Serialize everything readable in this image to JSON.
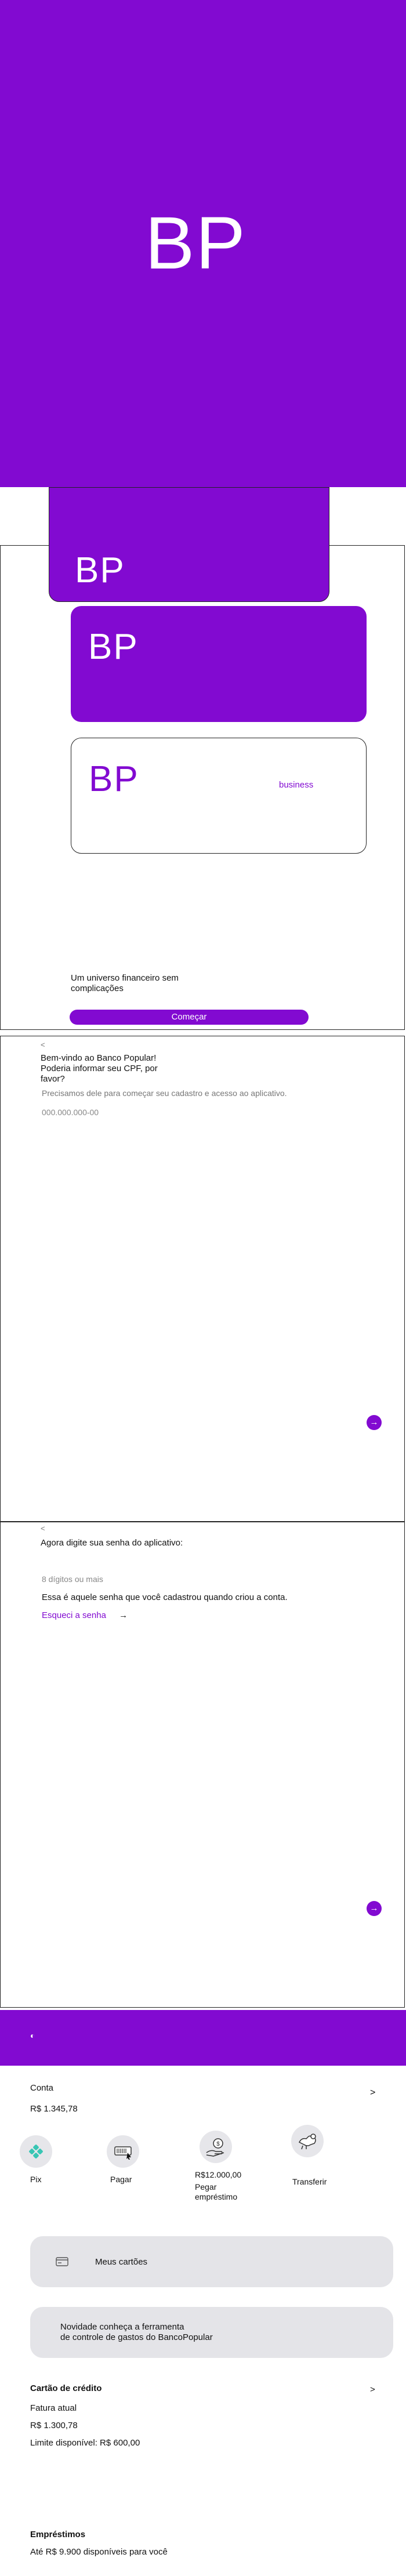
{
  "brand": {
    "logo_text": "BP",
    "purple": "#820ad1"
  },
  "splash": {
    "logo": "BP"
  },
  "onboarding": {
    "card1_logo": "BP",
    "card2_logo": "BP",
    "card3_logo": "BP",
    "card3_tag": "business",
    "tagline_line1": "Um universo financeiro sem",
    "tagline_line2": "complicações",
    "start_button": "Começar"
  },
  "cpf_screen": {
    "back": "<",
    "greeting_line1": "Bem-vindo ao Banco Popular!",
    "greeting_line2": "Poderia informar seu CPF, por",
    "greeting_line3": "favor?",
    "helper": "Precisamos dele para começar seu cadastro e acesso ao aplicativo.",
    "cpf_placeholder": "000.000.000-00",
    "next": "→"
  },
  "password_screen": {
    "back": "<",
    "title": "Agora digite sua senha do aplicativo:",
    "password_placeholder": "8 dígitos ou mais",
    "info": "Essa é aquele senha que você cadastrou quando criou a conta.",
    "forgot": "Esqueci a senha",
    "forgot_arrow": "→",
    "next": "→"
  },
  "home": {
    "eye_icon": "◐",
    "account_label": "Conta",
    "account_balance": "R$ 1.345,78",
    "account_chevron": ">",
    "actions": [
      {
        "label": "Pix",
        "icon": "pix-icon"
      },
      {
        "label": "Pagar",
        "icon": "barcode-icon"
      },
      {
        "label_line1": "R$12.000,00",
        "label_line2": "Pegar",
        "label_line3": "empréstimo",
        "icon": "loan-icon"
      },
      {
        "label": "Transferir",
        "icon": "transfer-icon"
      }
    ],
    "cards_label": "Meus cartões",
    "promo_line1": "Novidade conheça a ferramenta",
    "promo_line2": "de controle de gastos do BancoPopular",
    "credit": {
      "title": "Cartão de crédito",
      "chevron": ">",
      "current_bill_label": "Fatura atual",
      "current_bill_value": "R$ 1.300,78",
      "available_limit": "Limite disponível: R$ 600,00"
    },
    "loans": {
      "title": "Empréstimos",
      "subtitle": "Até R$ 9.900 disponíveis para você"
    }
  }
}
